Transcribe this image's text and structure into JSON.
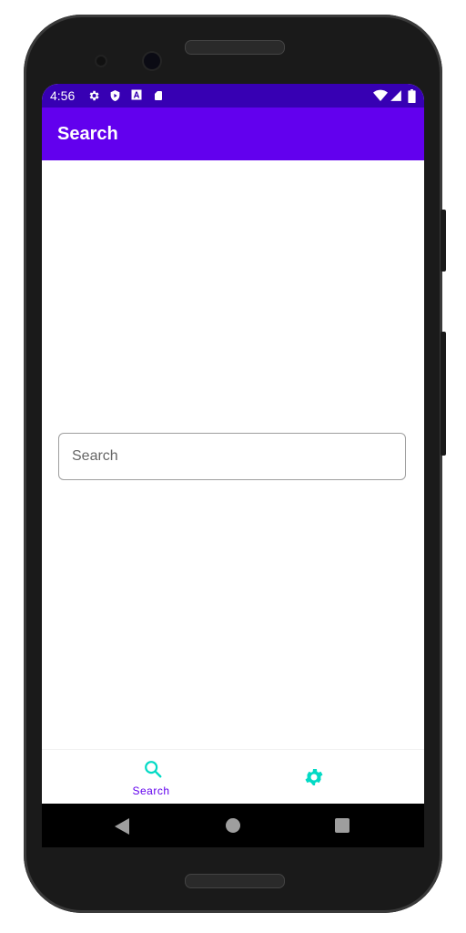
{
  "status_bar": {
    "time": "4:56",
    "left_icons": [
      "settings-icon",
      "play-protect-icon",
      "font-a-icon",
      "sd-card-icon"
    ],
    "right_icons": [
      "wifi-icon",
      "signal-icon",
      "battery-icon"
    ]
  },
  "app_bar": {
    "title": "Search"
  },
  "search": {
    "placeholder": "Search",
    "value": ""
  },
  "bottom_nav": {
    "items": [
      {
        "label": "Search",
        "icon": "search-icon",
        "selected": true
      },
      {
        "label": "",
        "icon": "gear-icon",
        "selected": false
      }
    ]
  },
  "colors": {
    "status_bar": "#3700b3",
    "primary": "#6200ee",
    "accent": "#03dac5"
  },
  "system_nav": {
    "buttons": [
      "back",
      "home",
      "recents"
    ]
  }
}
